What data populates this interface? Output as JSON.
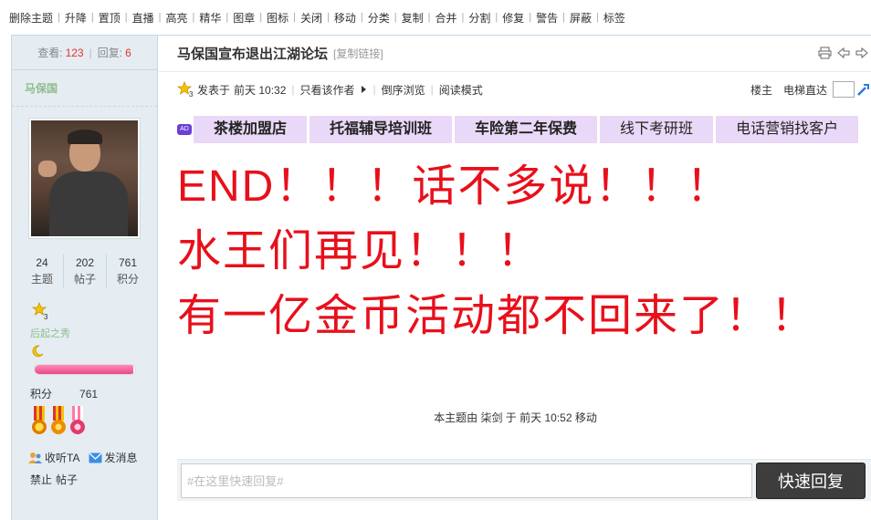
{
  "admin_bar": {
    "items": [
      "删除主题",
      "升降",
      "置顶",
      "直播",
      "高亮",
      "精华",
      "图章",
      "图标",
      "关闭",
      "移动",
      "分类",
      "复制",
      "合并",
      "分割",
      "修复",
      "警告",
      "屏蔽",
      "标签"
    ]
  },
  "sidebar": {
    "views_label": "查看:",
    "views": "123",
    "replies_label": "回复:",
    "replies": "6",
    "author_name": "马保国",
    "stats": [
      {
        "value": "24",
        "label": "主题"
      },
      {
        "value": "202",
        "label": "帖子"
      },
      {
        "value": "761",
        "label": "积分"
      }
    ],
    "star_level": "3",
    "rank_title": "后起之秀",
    "progress_ratio": 0.98,
    "credit_label": "积分",
    "credit_value": "761",
    "follow_label": "收听TA",
    "message_label": "发消息",
    "ban_label": "禁止",
    "posts_label": "帖子"
  },
  "thread": {
    "title": "马保国宣布退出江湖论坛",
    "copy_link": "[复制链接]",
    "posted_label": "发表于",
    "posted_time": "前天 10:32",
    "only_author": "只看该作者",
    "reverse_view": "倒序浏览",
    "read_mode": "阅读模式",
    "floor_label": "楼主",
    "elevator_label": "电梯直达"
  },
  "ads": {
    "tag": "AD",
    "items": [
      "茶楼加盟店",
      "托福辅导培训班",
      "车险第二年保费",
      "线下考研班",
      "电话营销找客户"
    ]
  },
  "post": {
    "lines": [
      "END！！！话不多说！！！",
      "水王们再见！！！",
      "有一亿金币活动都不回来了！！"
    ],
    "moved_note": "本主题由 柒剑 于 前天 10:52 移动"
  },
  "reply": {
    "placeholder": "#在这里快速回复#",
    "button_label": "快速回复"
  },
  "colors": {
    "accent_red": "#e8101b",
    "sidebar_bg": "#e5edf2",
    "ad_bg": "#e9d8f7",
    "rank_green": "#8fbc8f"
  }
}
